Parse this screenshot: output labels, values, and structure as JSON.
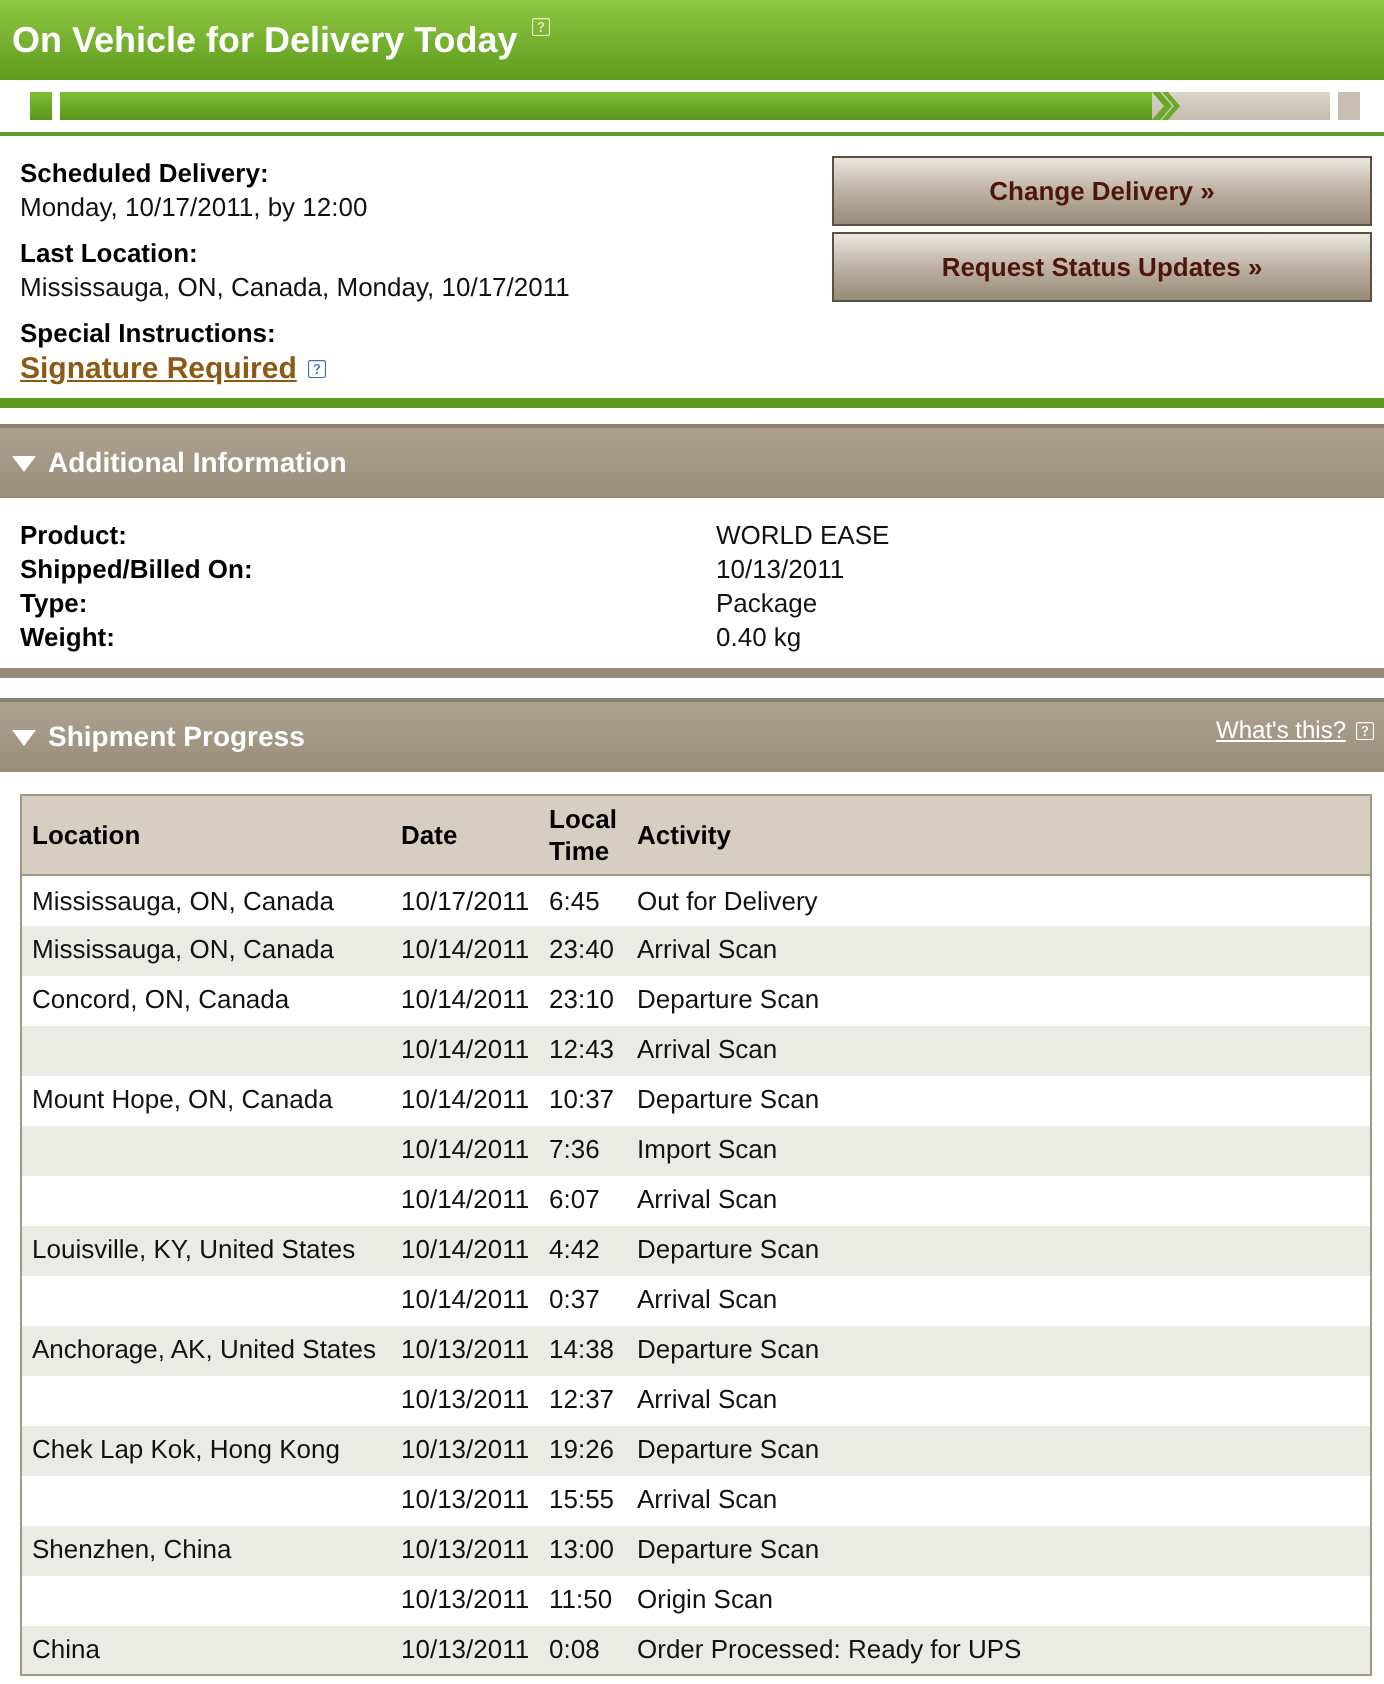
{
  "header": {
    "title": "On Vehicle for Delivery Today"
  },
  "progress": {
    "level": 0.86
  },
  "details": [
    {
      "kind": "text",
      "label": "Scheduled Delivery:",
      "value": "Monday, 10/17/2011, by 12:00"
    },
    {
      "kind": "text",
      "label": "Last Location:",
      "value": "Mississauga, ON, Canada, Monday, 10/17/2011"
    },
    {
      "kind": "link",
      "label": "Special Instructions:",
      "value": "Signature Required"
    }
  ],
  "buttons": [
    "Change Delivery »",
    "Request Status Updates »"
  ],
  "additional_information": {
    "title": "Additional Information",
    "expanded": true,
    "rows": [
      {
        "label": "Product:",
        "value": "WORLD EASE"
      },
      {
        "label": "Shipped/Billed On:",
        "value": "10/13/2011"
      },
      {
        "label": "Type:",
        "value": "Package"
      },
      {
        "label": "Weight:",
        "value": "0.40 kg"
      }
    ]
  },
  "shipment_progress": {
    "title": "Shipment Progress",
    "expanded": true,
    "help_link": "What's this?",
    "table": {
      "columns": [
        "Location",
        "Date",
        "Local Time",
        "Activity"
      ],
      "rows": [
        {
          "location": "Mississauga, ON, Canada",
          "date": "10/17/2011",
          "time": "6:45",
          "activity": "Out for Delivery"
        },
        {
          "location": "Mississauga, ON, Canada",
          "date": "10/14/2011",
          "time": "23:40",
          "activity": "Arrival Scan"
        },
        {
          "location": "Concord, ON, Canada",
          "date": "10/14/2011",
          "time": "23:10",
          "activity": "Departure Scan"
        },
        {
          "date": "10/14/2011",
          "time": "12:43",
          "activity": "Arrival Scan"
        },
        {
          "location": "Mount Hope, ON, Canada",
          "date": "10/14/2011",
          "time": "10:37",
          "activity": "Departure Scan"
        },
        {
          "date": "10/14/2011",
          "time": "7:36",
          "activity": "Import Scan"
        },
        {
          "date": "10/14/2011",
          "time": "6:07",
          "activity": "Arrival Scan"
        },
        {
          "location": "Louisville, KY, United States",
          "date": "10/14/2011",
          "time": "4:42",
          "activity": "Departure Scan"
        },
        {
          "date": "10/14/2011",
          "time": "0:37",
          "activity": "Arrival Scan"
        },
        {
          "location": "Anchorage, AK, United States",
          "date": "10/13/2011",
          "time": "14:38",
          "activity": "Departure Scan"
        },
        {
          "date": "10/13/2011",
          "time": "12:37",
          "activity": "Arrival Scan"
        },
        {
          "location": "Chek Lap Kok, Hong Kong",
          "date": "10/13/2011",
          "time": "19:26",
          "activity": "Departure Scan"
        },
        {
          "date": "10/13/2011",
          "time": "15:55",
          "activity": "Arrival Scan"
        },
        {
          "location": "Shenzhen, China",
          "date": "10/13/2011",
          "time": "13:00",
          "activity": "Departure Scan"
        },
        {
          "date": "10/13/2011",
          "time": "11:50",
          "activity": "Origin Scan"
        },
        {
          "location": "China",
          "date": "10/13/2011",
          "time": "0:08",
          "activity": "Order Processed: Ready for UPS"
        }
      ]
    }
  }
}
